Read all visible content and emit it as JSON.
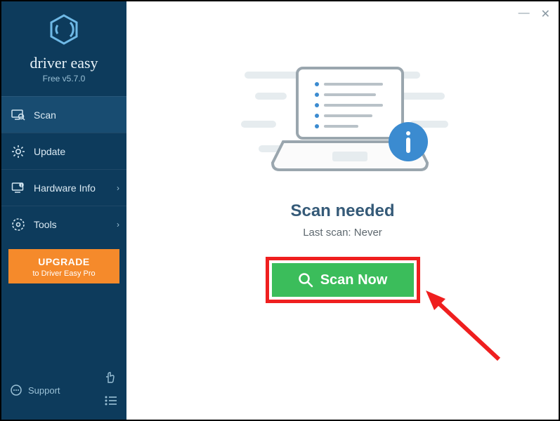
{
  "app": {
    "name": "driver easy",
    "version": "Free v5.7.0"
  },
  "sidebar": {
    "items": [
      {
        "label": "Scan"
      },
      {
        "label": "Update"
      },
      {
        "label": "Hardware Info"
      },
      {
        "label": "Tools"
      }
    ],
    "upgrade": {
      "title": "UPGRADE",
      "subtitle": "to Driver Easy Pro"
    },
    "support": "Support"
  },
  "main": {
    "headline": "Scan needed",
    "lastScanPrefix": "Last scan: ",
    "lastScanValue": "Never",
    "scanButton": "Scan Now"
  }
}
